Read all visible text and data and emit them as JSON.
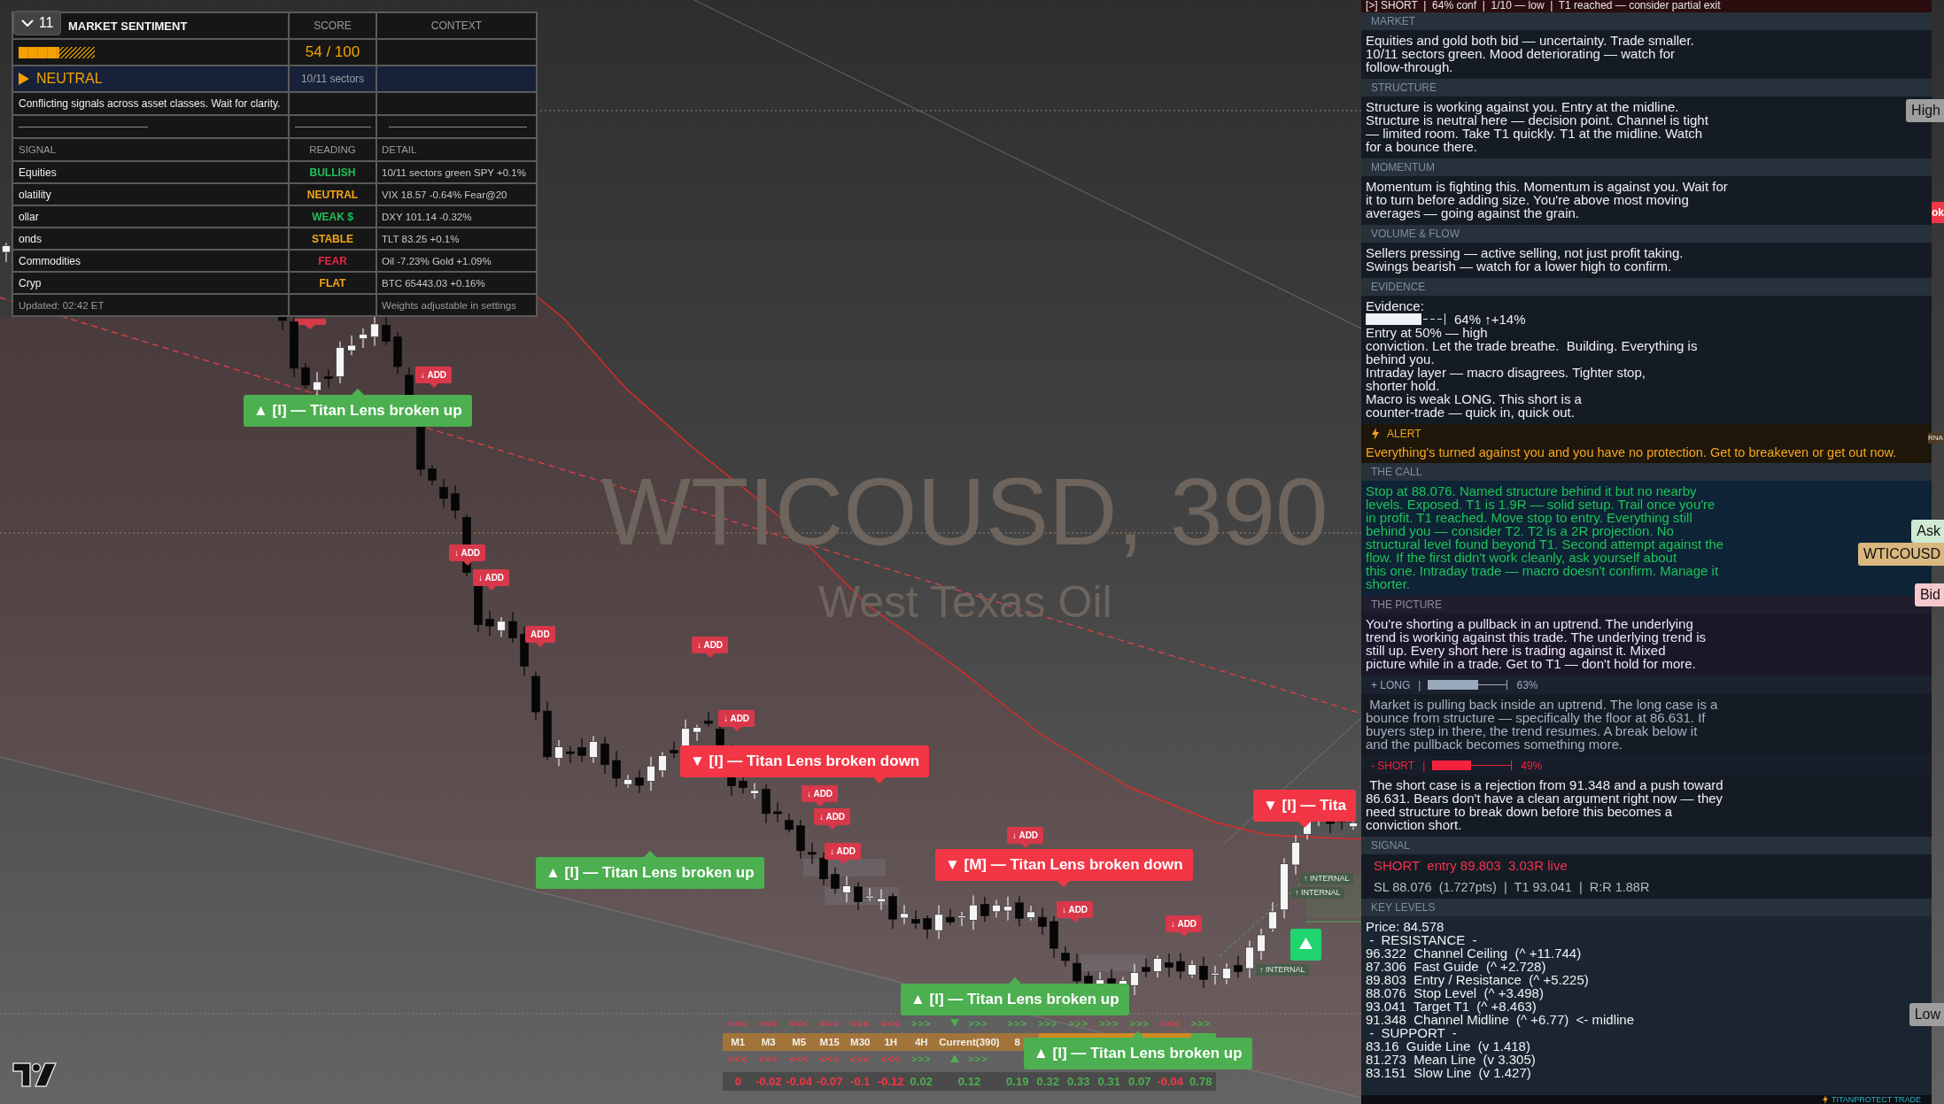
{
  "sentiment": {
    "title": "MARKET SENTIMENT",
    "score_header": "SCORE",
    "context_header": "CONTEXT",
    "score_bar": {
      "level": 0.54
    },
    "score": "54 / 100",
    "verdict": "NEUTRAL",
    "sectors": "10/11 sectors",
    "summary": "Conflicting signals across asset classes. Wait for clarity.",
    "columns": [
      "SIGNAL",
      "READING",
      "DETAIL"
    ],
    "rows": [
      {
        "signal": "Equities",
        "reading": "BULLISH",
        "color": "#1fbf5a",
        "detail": "10/11 sectors green  SPY +0.1%"
      },
      {
        "signal": "olatility",
        "reading": "NEUTRAL",
        "color": "#f2a516",
        "detail": "VIX 18.57  -0.64%  Fear@20"
      },
      {
        "signal": "ollar",
        "reading": "WEAK $",
        "color": "#1fbf5a",
        "detail": "DXY 101.14  -0.32%"
      },
      {
        "signal": "onds",
        "reading": "STABLE",
        "color": "#f2a516",
        "detail": "TLT 83.25  +0.1%"
      },
      {
        "signal": "Commodities",
        "reading": "FEAR",
        "color": "#ea2445",
        "detail": "Oil -7.23%  Gold +1.09%"
      },
      {
        "signal": "Cryp",
        "reading": "FLAT",
        "color": "#f2a516",
        "detail": "BTC 65443.03  +0.16%"
      }
    ],
    "updated": "Updated: 02:42 ET",
    "note": "Weights adjustable in settings"
  },
  "chart": {
    "indicator_toggle": {
      "count": "11"
    },
    "watermark": {
      "symbol": "WTICOUSD, 390",
      "description": "West Texas Oil"
    },
    "signals": [
      {
        "kind": "break_up",
        "text": "▲ [I] — Titan Lens broken up"
      },
      {
        "kind": "break_up",
        "text": "▲ [I] — Titan Lens broken up"
      },
      {
        "kind": "break_up",
        "text": "▲ [I] — Titan Lens broken up"
      },
      {
        "kind": "break_up",
        "text": "▲ [I] — Titan Lens broken up"
      },
      {
        "kind": "break_down",
        "text": "▼ [I] — Titan Lens broken down"
      },
      {
        "kind": "break_down",
        "text": "▼ [M] — Titan Lens broken down"
      },
      {
        "kind": "break_down",
        "text": "▼ [I] — Tita"
      }
    ],
    "add_marks": [
      "↓ ADD",
      "↓ ADD",
      "↓ ADD",
      "ADD",
      "↓ ADD",
      "↓ ADD",
      "↓ ADD",
      "↓ ADD",
      "↓ ADD",
      "↓ ADD",
      "↓ ADD",
      "↓ ADD"
    ],
    "internal_marks": [
      "↑ INTERNAL",
      "↑ INTERNAL",
      "↑ INTERNAL"
    ]
  },
  "timeframes": {
    "columns": [
      {
        "kind": "timeframe",
        "label": "M1",
        "color": "#f23645",
        "upper": "<<<",
        "lower": "<<<",
        "value": "0"
      },
      {
        "kind": "timeframe",
        "label": "M3",
        "color": "#f23645",
        "upper": "<<<",
        "lower": "<<<",
        "value": "-0.02"
      },
      {
        "kind": "timeframe",
        "label": "M5",
        "color": "#f23645",
        "upper": "<<<",
        "lower": "<<<",
        "value": "-0.04"
      },
      {
        "kind": "timeframe",
        "label": "M15",
        "color": "#f23645",
        "upper": "<<<",
        "lower": "<<<",
        "value": "-0.07"
      },
      {
        "kind": "timeframe",
        "label": "M30",
        "color": "#f23645",
        "upper": "<<<",
        "lower": "<<<",
        "value": "-0.1"
      },
      {
        "kind": "timeframe",
        "label": "1H",
        "color": "#f23645",
        "upper": "<<<",
        "lower": "<<<",
        "value": "-0.12"
      },
      {
        "kind": "timeframe",
        "label": "4H",
        "color": "#4caf50",
        "upper": ">>>",
        "lower": ">>>",
        "value": "0.02"
      },
      {
        "kind": "current",
        "label": "Current(390)",
        "color": "#4caf50",
        "upper": ">>>",
        "lower": ">>>",
        "value": "0.12"
      },
      {
        "kind": "timeframe",
        "label": "8",
        "color": "#4caf50",
        "upper": ">>>",
        "value": "0.19"
      },
      {
        "kind": "timeframe",
        "color": "#4caf50",
        "upper": ">>>",
        "value": "0.32"
      },
      {
        "kind": "timeframe",
        "color": "#4caf50",
        "upper": ">>>",
        "value": "0.33"
      },
      {
        "kind": "timeframe",
        "color": "#4caf50",
        "upper": ">>>",
        "value": "0.31"
      },
      {
        "kind": "timeframe",
        "color": "#4caf50",
        "upper": ">>>",
        "value": "0.07"
      },
      {
        "kind": "timeframe",
        "color": "#f23645",
        "upper": "<<<",
        "value": "-0.04"
      },
      {
        "kind": "timeframe",
        "color": "#4caf50",
        "upper": ">>>",
        "value": "0.78"
      }
    ]
  },
  "panel": {
    "status": "[>] SHORT  |  64% conf  |  1/10 — low  |  T1 reached — consider partial exit",
    "sections": [
      {
        "kind": "note",
        "title": "MARKET",
        "body": "Equities and gold both bid — uncertainty. Trade smaller.\n10/11 sectors green. Mood deteriorating — watch for\nfollow-through."
      },
      {
        "kind": "note",
        "title": "STRUCTURE",
        "body": "Structure is working against you. Entry at the midline.\nStructure is neutral here — decision point. Channel is tight\n— limited room. Take T1 quickly. T1 at the midline. Watch\nfor a bounce there."
      },
      {
        "kind": "note",
        "title": "MOMENTUM",
        "body": "Momentum is fighting this. Momentum is against you. Wait for\nit to turn before adding size. You're above most moving\naverages — going against the grain."
      },
      {
        "kind": "note",
        "title": "VOLUME & FLOW",
        "body": "Sellers pressing — active selling, not just profit taking.\nSwings bearish — watch for a lower high to confirm."
      },
      {
        "kind": "evidence",
        "title": "EVIDENCE",
        "label": "Evidence:",
        "meter": {
          "level": 0.7,
          "reading": "64% ↑+14%"
        },
        "body": "Entry at 50% — high\nconviction. Let the trade breathe.  Building. Everything is\nbehind you.\nIntraday layer — macro disagrees. Tighter stop,\nshorter hold.\nMacro is weak LONG. This short is a\ncounter-trade — quick in, quick out."
      },
      {
        "kind": "alert",
        "title": "ALERT",
        "body": "Everything's turned against you and you have no protection. Get to breakeven or get out now."
      },
      {
        "kind": "call",
        "title": "THE CALL",
        "body": "Stop at 88.076. Named structure behind it but no nearby\nlevels. Exposed. T1 is 1.9R — solid setup. Trail once you're\nin profit. T1 reached. Move stop to entry. Everything still\nbehind you — consider T2. T2 is a 2R projection. No\nstructural level found beyond T1. Second attempt against the\nflow. If the first didn't work cleanly, ask yourself about\nthis one. Intraday trade — macro doesn't confirm. Manage it\nshorter."
      },
      {
        "kind": "picture",
        "title": "THE PICTURE",
        "body": "You're shorting a pullback in an uptrend. The underlying\ntrend is working against this trade. The underlying trend is\nstill up. Every short here is trading against it. Mixed\npicture while in a trade. Get to T1 — don't hold for more."
      },
      {
        "kind": "long_case",
        "label": "+ LONG",
        "separator": "|",
        "level": 0.63,
        "reading": "63%",
        "body": " Market is pulling back inside an uptrend. The long case is a\nbounce from structure — specifically the floor at 86.631. If\nbuyers step in there, the trend resumes. A break below it\nand the pullback becomes something more."
      },
      {
        "kind": "short_case",
        "label": "- SHORT",
        "separator": "|",
        "level": 0.49,
        "reading": "49%",
        "body": " The short case is a rejection from 91.348 and a push toward\n86.631. Bears don't have a clean argument right now — they\nneed structure to break down before this becomes a\nconviction short."
      },
      {
        "kind": "signal",
        "title": "SIGNAL",
        "headline": "SHORT  entry 89.803  3.03R live",
        "detail": "SL 88.076  (1.727pts)  |  T1 93.041  |  R:R 1.88R"
      },
      {
        "kind": "levels",
        "title": "KEY LEVELS",
        "lines": [
          "Price: 84.578",
          " -  RESISTANCE  -",
          "96.322  Channel Ceiling  (^ +11.744)",
          "87.306  Fast Guide  (^ +2.728)",
          "89.803  Entry / Resistance  (^ +5.225)",
          "88.076  Stop Level  (^ +3.498)",
          "93.041  Target T1  (^ +8.463)",
          "91.348  Channel Midline  (^ +6.77)  <- midline",
          " -  SUPPORT  -",
          "83.16  Guide Line  (v 1.418)",
          "81.273  Mean Line  (v 3.305)",
          "83.151  Slow Line  (v 1.427)"
        ]
      }
    ],
    "footer": "TITANPROTECT TRADE"
  },
  "price_axis": {
    "labels": [
      {
        "kind": "high",
        "text": "High"
      },
      {
        "kind": "ask",
        "text": "Ask"
      },
      {
        "kind": "symbol",
        "text": "WTICOUSD"
      },
      {
        "kind": "bid",
        "text": "Bid"
      },
      {
        "kind": "low",
        "text": "Low"
      }
    ],
    "fragments": [
      {
        "kind": "signal",
        "text": "ok"
      },
      {
        "kind": "internal",
        "text": "RNA"
      }
    ]
  }
}
